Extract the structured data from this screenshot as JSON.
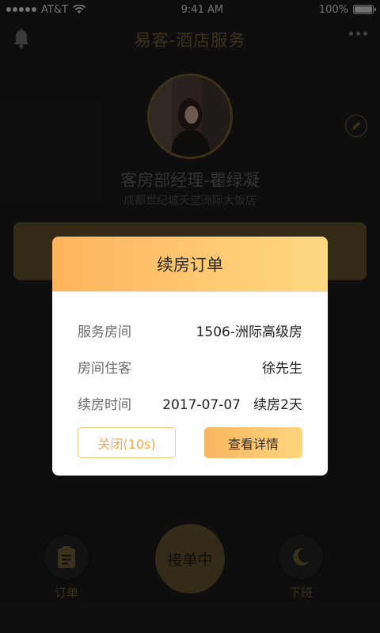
{
  "status_bar": {
    "carrier": "AT&T",
    "time": "9:41 AM",
    "battery": "100%"
  },
  "nav": {
    "title": "易客-酒店服务"
  },
  "profile": {
    "name": "客房部经理-瞿绿凝",
    "hotel": "成都世纪城天堂洲际大饭店"
  },
  "bottom": {
    "orders_label": "订单",
    "center_label": "接单中",
    "offduty_label": "下班"
  },
  "modal": {
    "title": "续房订单",
    "rows": [
      {
        "label": "服务房间",
        "value": "1506-洲际高级房"
      },
      {
        "label": "房间住客",
        "value": "徐先生"
      },
      {
        "label": "续房时间",
        "value": "2017-07-07   续房2天"
      }
    ],
    "close_label": "关闭(10s)",
    "detail_label": "查看详情"
  },
  "colors": {
    "accent": "#fdb45c",
    "gold": "#6d5c2f",
    "background": "#1b1b1b"
  }
}
